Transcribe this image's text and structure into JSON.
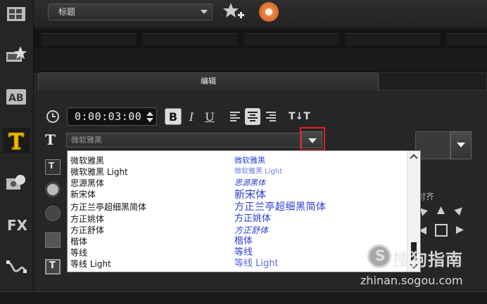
{
  "top": {
    "library_select": "标题"
  },
  "tabs": {
    "edit": "编辑"
  },
  "controls": {
    "timecode": "0:00:03:00",
    "bold": "B",
    "italic": "I",
    "underline": "U",
    "vertical_text": "T↓T",
    "t_icon": "T",
    "font_field": "微软雅黑"
  },
  "align_label": "对齐",
  "fonts": [
    {
      "name": "微软雅黑",
      "preview": "微软雅黑"
    },
    {
      "name": "微软雅黑 Light",
      "preview": "微软雅黑 Light"
    },
    {
      "name": "思源黑体",
      "preview": "思源黑体"
    },
    {
      "name": "新宋体",
      "preview": "新宋体"
    },
    {
      "name": "方正兰亭超细黑简体",
      "preview": "方正兰亭超细黑简体"
    },
    {
      "name": "方正姚体",
      "preview": "方正姚体"
    },
    {
      "name": "方正舒体",
      "preview": "方正舒体"
    },
    {
      "name": "楷体",
      "preview": "楷体"
    },
    {
      "name": "等线",
      "preview": "等线"
    },
    {
      "name": "等线 Light",
      "preview": "等线 Light"
    }
  ],
  "watermark": {
    "cn": "搜狗指南",
    "url": "zhinan.sogou.com"
  },
  "colors": {
    "highlight": "#e02020",
    "preview_text": "#2a3fd0"
  }
}
